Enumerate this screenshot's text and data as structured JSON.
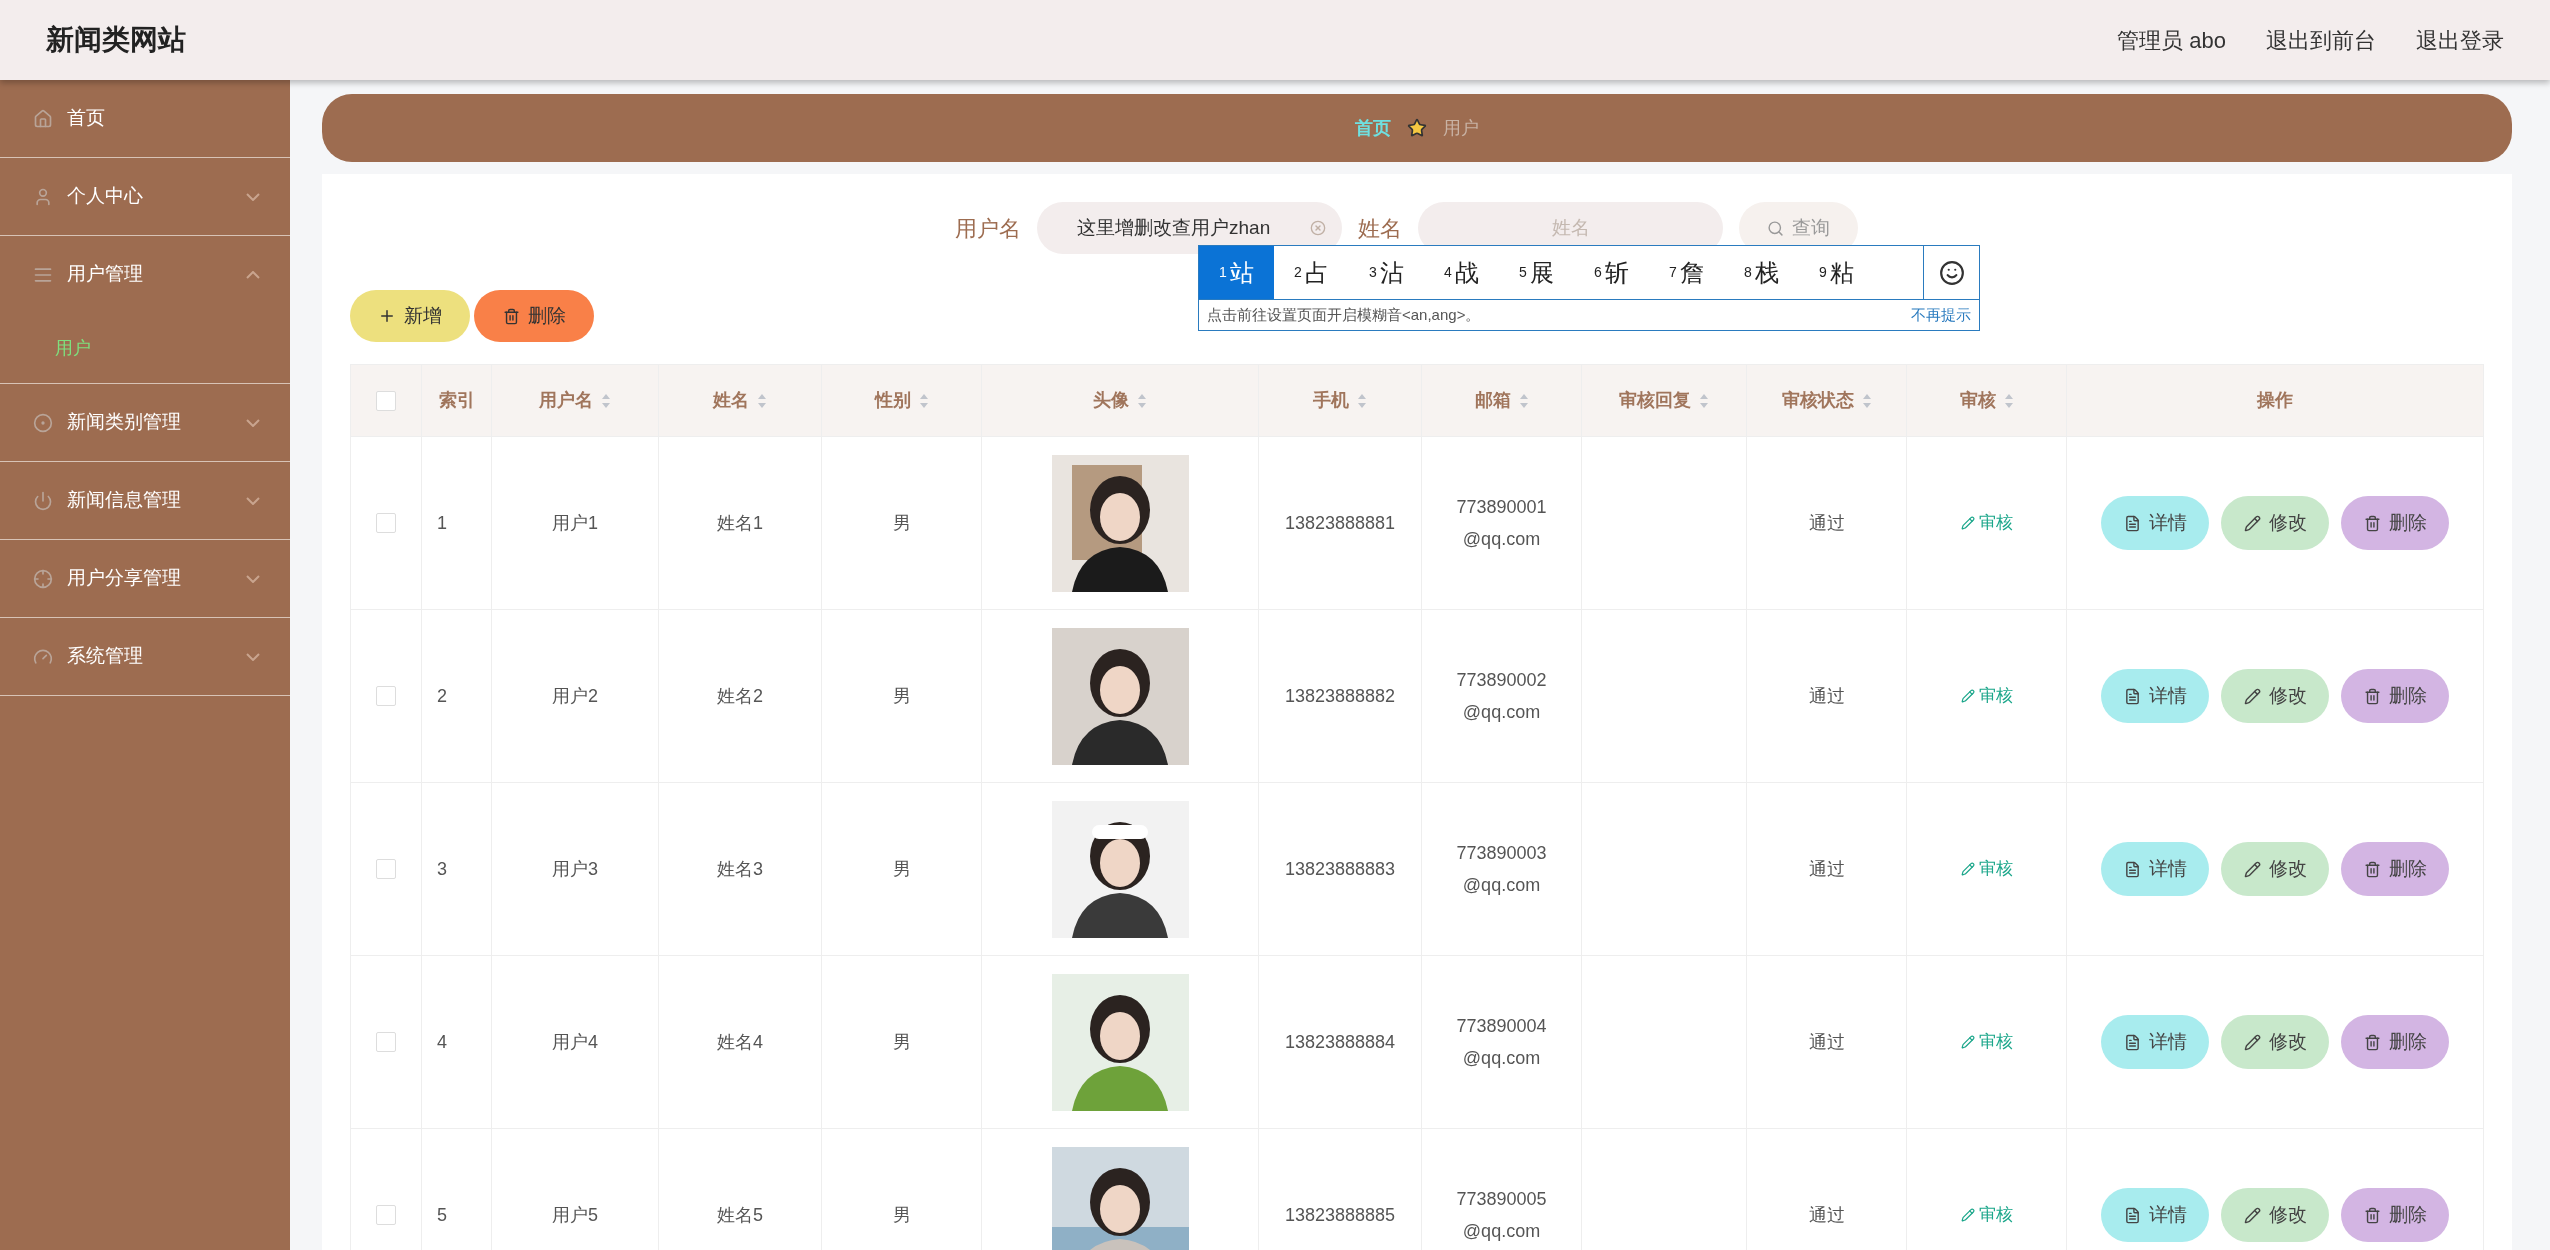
{
  "header": {
    "title": "新闻类网站",
    "links": [
      "管理员 abo",
      "退出到前台",
      "退出登录"
    ]
  },
  "sidebar": {
    "items": [
      {
        "label": "首页"
      },
      {
        "label": "个人中心",
        "expanded": false
      },
      {
        "label": "用户管理",
        "expanded": true,
        "children": [
          {
            "label": "用户",
            "selected": true
          }
        ]
      },
      {
        "label": "新闻类别管理",
        "expanded": false
      },
      {
        "label": "新闻信息管理",
        "expanded": false
      },
      {
        "label": "用户分享管理",
        "expanded": false
      },
      {
        "label": "系统管理",
        "expanded": false
      }
    ]
  },
  "breadcrumb": {
    "home": "首页",
    "current": "用户"
  },
  "search": {
    "fields": [
      {
        "label": "用户名",
        "value": "这里增删改查用户zhan"
      },
      {
        "label": "姓名",
        "placeholder": "姓名"
      }
    ],
    "button": "查询"
  },
  "ime": {
    "candidates": [
      {
        "number": "1",
        "char": "站",
        "selected": true
      },
      {
        "number": "2",
        "char": "占",
        "selected": false
      },
      {
        "number": "3",
        "char": "沾",
        "selected": false
      },
      {
        "number": "4",
        "char": "战",
        "selected": false
      },
      {
        "number": "5",
        "char": "展",
        "selected": false
      },
      {
        "number": "6",
        "char": "斩",
        "selected": false
      },
      {
        "number": "7",
        "char": "詹",
        "selected": false
      },
      {
        "number": "8",
        "char": "栈",
        "selected": false
      },
      {
        "number": "9",
        "char": "粘",
        "selected": false
      }
    ],
    "hint": "点击前往设置页面开启模糊音<an,ang>。",
    "dismiss": "不再提示"
  },
  "actions": [
    "新增",
    "删除"
  ],
  "table": {
    "all_checked": false,
    "columns": [
      {
        "label": "索引",
        "sortable": false
      },
      {
        "label": "用户名",
        "sortable": true
      },
      {
        "label": "姓名",
        "sortable": true
      },
      {
        "label": "性别",
        "sortable": true
      },
      {
        "label": "头像",
        "sortable": true
      },
      {
        "label": "手机",
        "sortable": true
      },
      {
        "label": "邮箱",
        "sortable": true
      },
      {
        "label": "审核回复",
        "sortable": true
      },
      {
        "label": "审核状态",
        "sortable": true
      },
      {
        "label": "审核",
        "sortable": true
      },
      {
        "label": "操作"
      }
    ],
    "rows": [
      {
        "checked": false,
        "index": "1",
        "username": "用户1",
        "name": "姓名1",
        "gender": "男",
        "phone": "13823888881",
        "email": "773890001@qq.com",
        "status": "通过",
        "audit": "审核",
        "buttons": [
          "详情",
          "修改",
          "删除"
        ]
      },
      {
        "checked": false,
        "index": "2",
        "username": "用户2",
        "name": "姓名2",
        "gender": "男",
        "phone": "13823888882",
        "email": "773890002@qq.com",
        "status": "通过",
        "audit": "审核",
        "buttons": [
          "详情",
          "修改",
          "删除"
        ]
      },
      {
        "checked": false,
        "index": "3",
        "username": "用户3",
        "name": "姓名3",
        "gender": "男",
        "phone": "13823888883",
        "email": "773890003@qq.com",
        "status": "通过",
        "audit": "审核",
        "buttons": [
          "详情",
          "修改",
          "删除"
        ]
      },
      {
        "checked": false,
        "index": "4",
        "username": "用户4",
        "name": "姓名4",
        "gender": "男",
        "phone": "13823888884",
        "email": "773890004@qq.com",
        "status": "通过",
        "audit": "审核",
        "buttons": [
          "详情",
          "修改",
          "删除"
        ]
      },
      {
        "checked": false,
        "index": "5",
        "username": "用户5",
        "name": "姓名5",
        "gender": "男",
        "phone": "13823888885",
        "email": "773890005@qq.com",
        "status": "通过",
        "audit": "审核",
        "buttons": [
          "详情",
          "修改",
          "删除"
        ]
      }
    ]
  }
}
